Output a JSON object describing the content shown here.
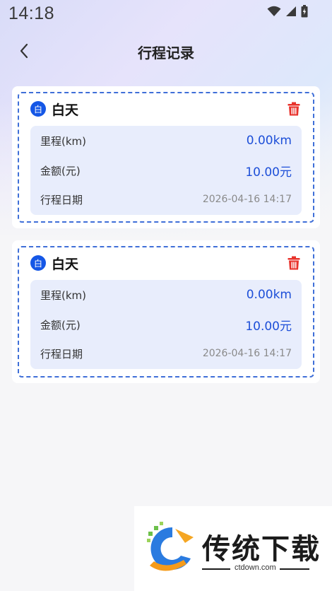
{
  "status_bar": {
    "time": "14:18"
  },
  "header": {
    "title": "行程记录"
  },
  "records": [
    {
      "mode_badge": "白",
      "mode_label": "白天",
      "mileage_label": "里程(km)",
      "mileage_value": "0.00km",
      "amount_label": "金额(元)",
      "amount_value": "10.00元",
      "date_label": "行程日期",
      "date_value": "2026-04-16 14:17"
    },
    {
      "mode_badge": "白",
      "mode_label": "白天",
      "mileage_label": "里程(km)",
      "mileage_value": "0.00km",
      "amount_label": "金额(元)",
      "amount_value": "10.00元",
      "date_label": "行程日期",
      "date_value": "2026-04-16 14:17"
    }
  ],
  "watermark": {
    "title": "传统下载",
    "url": "ctdown.com"
  },
  "colors": {
    "accent": "#1557e6",
    "delete": "#e8322b",
    "info_bg": "#e8edfc"
  },
  "icons": [
    "wifi-icon",
    "signal-icon",
    "battery-icon",
    "back-icon",
    "trash-icon"
  ]
}
